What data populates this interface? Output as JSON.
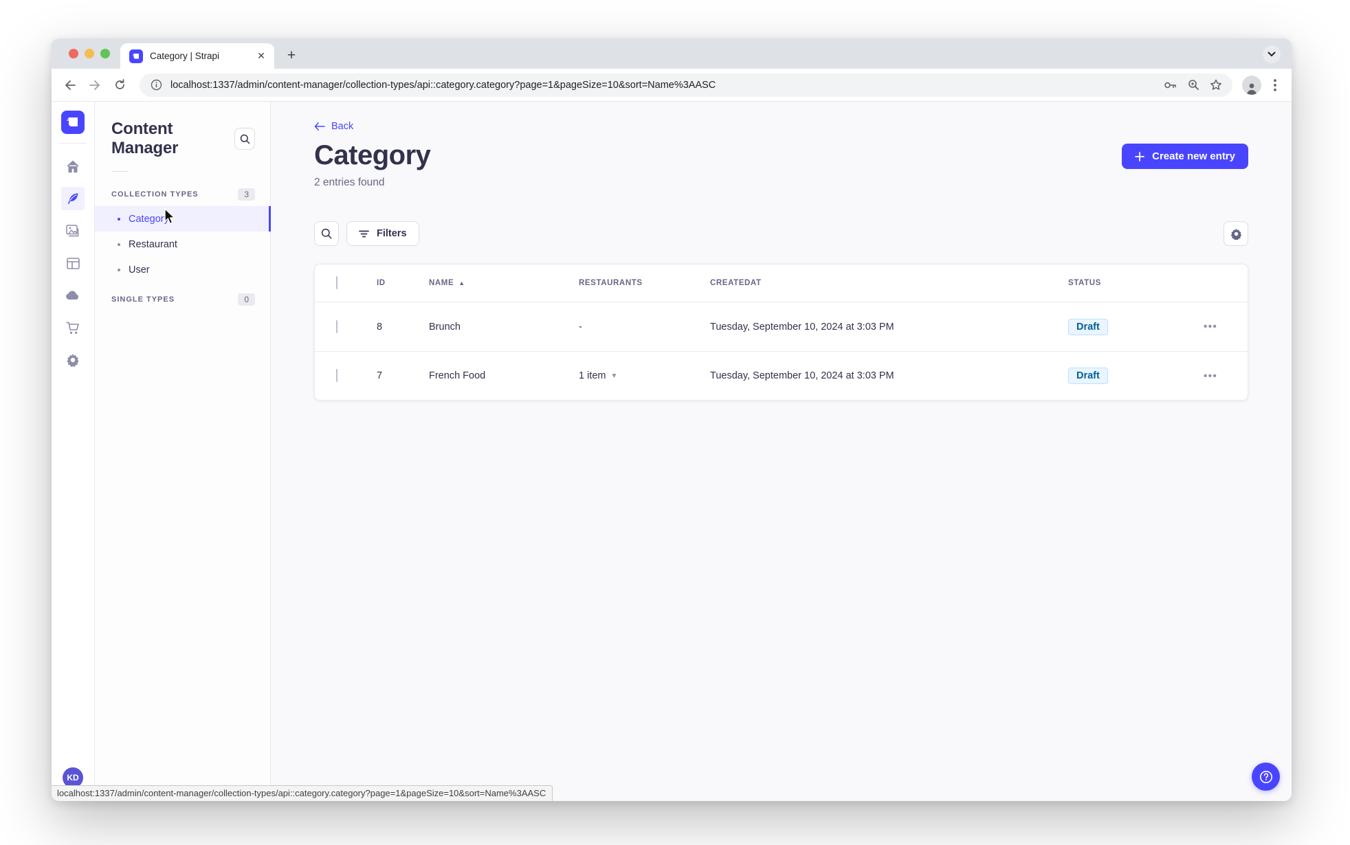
{
  "browser": {
    "tab_title": "Category | Strapi",
    "url": "localhost:1337/admin/content-manager/collection-types/api::category.category?page=1&pageSize=10&sort=Name%3AASC",
    "status_bar_url": "localhost:1337/admin/content-manager/collection-types/api::category.category?page=1&pageSize=10&sort=Name%3AASC"
  },
  "sidebar": {
    "title": "Content Manager",
    "collection_section": {
      "label": "COLLECTION TYPES",
      "badge": "3"
    },
    "collection_items": [
      {
        "label": "Category",
        "active": true
      },
      {
        "label": "Restaurant",
        "active": false
      },
      {
        "label": "User",
        "active": false
      }
    ],
    "single_section": {
      "label": "SINGLE TYPES",
      "badge": "0"
    }
  },
  "header": {
    "back_label": "Back",
    "title": "Category",
    "subtitle": "2 entries found",
    "create_button_label": "Create new entry"
  },
  "toolbar": {
    "filters_label": "Filters"
  },
  "table": {
    "columns": [
      "ID",
      "NAME",
      "RESTAURANTS",
      "CREATEDAT",
      "STATUS"
    ],
    "rows": [
      {
        "id": "8",
        "name": "Brunch",
        "restaurants": "-",
        "created_at": "Tuesday, September 10, 2024 at 3:03 PM",
        "status": "Draft"
      },
      {
        "id": "7",
        "name": "French Food",
        "restaurants": "1 item",
        "created_at": "Tuesday, September 10, 2024 at 3:03 PM",
        "status": "Draft"
      }
    ]
  },
  "user": {
    "avatar_initials": "KD"
  },
  "colors": {
    "primary": "#4945ff",
    "active_item_bg": "#f0f0ff",
    "text_dark": "#32324d",
    "text_muted": "#666687",
    "border": "#eaeaef",
    "draft_bg": "#eaf5ff",
    "draft_border": "#b8e1ff",
    "draft_text": "#006096"
  }
}
